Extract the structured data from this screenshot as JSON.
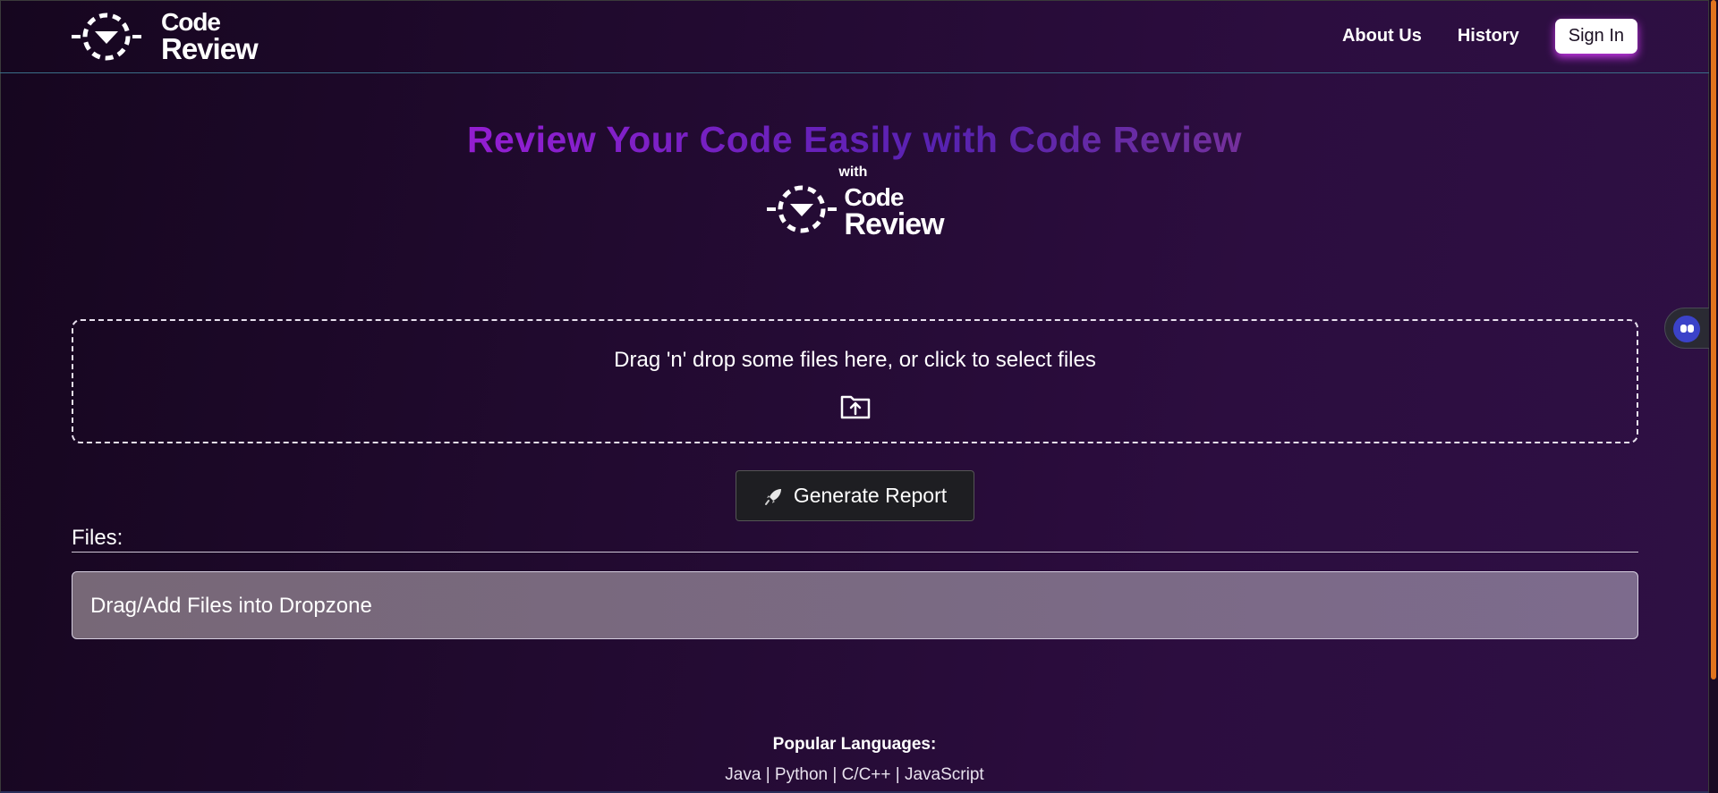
{
  "header": {
    "logo_line1": "Code",
    "logo_line2": "Review",
    "nav": [
      "About Us",
      "History"
    ],
    "signin_label": "Sign In"
  },
  "hero": {
    "title": "Review Your Code Easily with Code Review",
    "with_label": "with",
    "logo_line1": "Code",
    "logo_line2": "Review"
  },
  "dropzone": {
    "text": "Drag 'n' drop some files here, or click to select files",
    "icon": "folder-upload-icon"
  },
  "generate": {
    "label": "Generate Report",
    "icon": "rocket-icon"
  },
  "files": {
    "label": "Files:",
    "placeholder": "Drag/Add Files into Dropzone"
  },
  "footer": {
    "popular_title": "Popular Languages:",
    "popular_list": "Java | Python | C/C++ | JavaScript"
  },
  "colors": {
    "accent_shadow": "#dc3cff",
    "scroll_thumb": "#e0741f",
    "title_gradient_start": "#b60fd9",
    "title_gradient_end": "#b8406a"
  }
}
